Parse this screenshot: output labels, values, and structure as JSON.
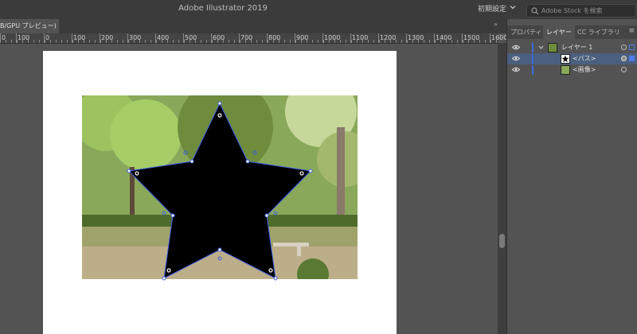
{
  "app": {
    "title": "Adobe Illustrator 2019",
    "workspace": "初期設定",
    "stock_placeholder": "Adobe Stock を検索"
  },
  "document": {
    "tab_label": "B/GPU プレビュー)"
  },
  "ruler": {
    "labels": [
      "0",
      "100",
      "0",
      "100",
      "200",
      "300",
      "400",
      "500",
      "600",
      "700",
      "800",
      "900",
      "1000",
      "1100",
      "1200",
      "1300",
      "1400",
      "1500",
      "1600"
    ]
  },
  "panel": {
    "tabs": [
      "プロパティ",
      "レイヤー",
      "CC ライブラリ"
    ],
    "active_tab": "レイヤー",
    "collapse_glyph": "»",
    "menu_glyph": "≡",
    "layers": [
      {
        "name": "レイヤー 1",
        "expanded": true,
        "thumb": "layer-thumb"
      },
      {
        "name": "<パス>",
        "selected": true,
        "thumb": "star-thumb"
      },
      {
        "name": "<画像>",
        "thumb": "image-thumb"
      }
    ]
  },
  "colors": {
    "accent": "#3d6bdb",
    "selection_row": "#4b5f7e",
    "star_fill": "#000000",
    "path_outline": "#3d5ee0"
  }
}
